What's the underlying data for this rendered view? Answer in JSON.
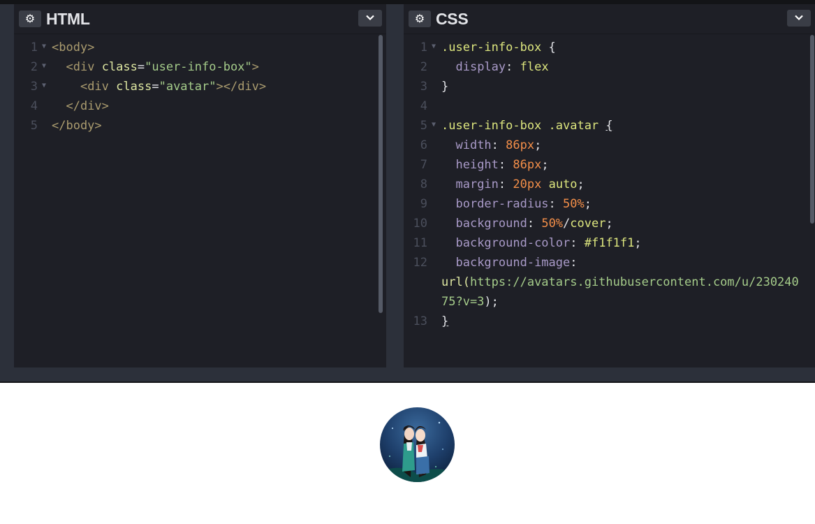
{
  "html_panel": {
    "gear_icon": "gear-icon",
    "title": "HTML",
    "collapse_icon": "chevron-down-icon",
    "lines": [
      {
        "num": "1",
        "fold": true
      },
      {
        "num": "2",
        "fold": true
      },
      {
        "num": "3",
        "fold": true
      },
      {
        "num": "4",
        "fold": false
      },
      {
        "num": "5",
        "fold": false
      }
    ],
    "code": {
      "l1_tag": "<body>",
      "l2_open": "<div",
      "l2_attr": "class",
      "l2_eq": "=",
      "l2_val": "\"user-info-box\"",
      "l2_close": ">",
      "l3_open": "<div",
      "l3_attr": "class",
      "l3_eq": "=",
      "l3_val": "\"avatar\"",
      "l3_close": "></div>",
      "l4_tag": "</div>",
      "l5_tag": "</body>"
    }
  },
  "css_panel": {
    "gear_icon": "gear-icon",
    "title": "CSS",
    "collapse_icon": "chevron-down-icon",
    "lines": [
      {
        "num": "1",
        "fold": true
      },
      {
        "num": "2",
        "fold": false
      },
      {
        "num": "3",
        "fold": false
      },
      {
        "num": "4",
        "fold": false
      },
      {
        "num": "5",
        "fold": true
      },
      {
        "num": "6",
        "fold": false
      },
      {
        "num": "7",
        "fold": false
      },
      {
        "num": "8",
        "fold": false
      },
      {
        "num": "9",
        "fold": false
      },
      {
        "num": "10",
        "fold": false
      },
      {
        "num": "11",
        "fold": false
      },
      {
        "num": "12",
        "fold": false
      },
      {
        "num": "13",
        "fold": false
      }
    ],
    "code": {
      "l1_sel": ".user-info-box",
      "l1_brace": " {",
      "l2_prop": "display",
      "l2_colon": ": ",
      "l2_val": "flex",
      "l3_brace": "}",
      "l5_sel": ".user-info-box .avatar",
      "l5_brace": "{",
      "l6_prop": "width",
      "l6_val": "86px",
      "l7_prop": "height",
      "l7_val": "86px",
      "l8_prop": "margin",
      "l8_val1": "20px",
      "l8_val2": "auto",
      "l9_prop": "border-radius",
      "l9_val": "50%",
      "l10_prop": "background",
      "l10_val1": "50%",
      "l10_slash": "/",
      "l10_val2": "cover",
      "l11_prop": "background-color",
      "l11_val": "#f1f1f1",
      "l12_prop": "background-image",
      "l12_fn": "url(",
      "l12_url1": "https://avatars.githubusercontent.com/u/230240",
      "l12_url2": "75?v=3",
      "l12_end": ");",
      "l13_brace": "}",
      "colon": ": ",
      "semi": ";"
    }
  },
  "preview": {
    "avatar_image": "avatar-image"
  },
  "colors": {
    "editor_bg": "#1e1f26",
    "chrome_bg": "#2c303a",
    "preview_bg": "#ffffff"
  }
}
